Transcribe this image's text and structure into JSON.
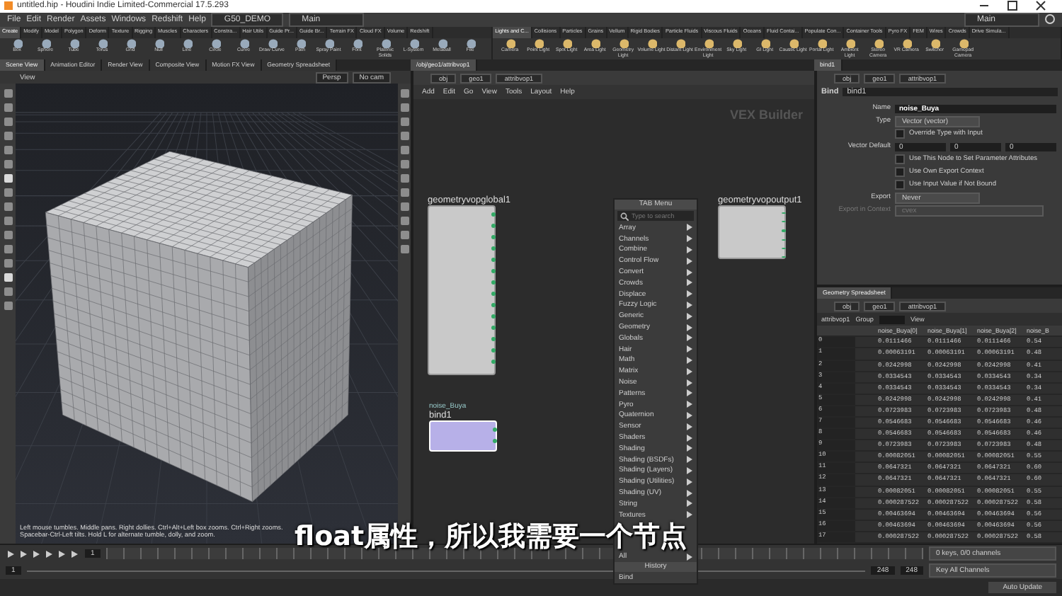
{
  "window": {
    "title": "untitled.hip - Houdini Indie Limited-Commercial 17.5.293"
  },
  "menu_bar": {
    "items": [
      "File",
      "Edit",
      "Render",
      "Assets",
      "Windows",
      "Redshift",
      "Help"
    ],
    "desktop": "G50_DEMO",
    "main": "Main"
  },
  "title_main": "Main",
  "shelf_left": {
    "tabs": [
      {
        "label": "Create",
        "selected": true
      },
      {
        "label": "Modify",
        "selected": false
      },
      {
        "label": "Model",
        "selected": false
      },
      {
        "label": "Polygon",
        "selected": false
      },
      {
        "label": "Deform",
        "selected": false
      },
      {
        "label": "Texture",
        "selected": false
      },
      {
        "label": "Rigging",
        "selected": false
      },
      {
        "label": "Muscles",
        "selected": false
      },
      {
        "label": "Characters",
        "selected": false
      },
      {
        "label": "Constra...",
        "selected": false
      },
      {
        "label": "Hair Utils",
        "selected": false
      },
      {
        "label": "Guide Pr...",
        "selected": false
      },
      {
        "label": "Guide Br...",
        "selected": false
      },
      {
        "label": "Terrain FX",
        "selected": false
      },
      {
        "label": "Cloud FX",
        "selected": false
      },
      {
        "label": "Volume",
        "selected": false
      },
      {
        "label": "Redshift",
        "selected": false
      }
    ],
    "tools": [
      "Box",
      "Sphere",
      "Tube",
      "Torus",
      "Grid",
      "Null",
      "Line",
      "Circle",
      "Curve",
      "Draw Curve",
      "Path",
      "Spray Paint",
      "Font",
      "Platonic Solids",
      "L-System",
      "Metaball",
      "File"
    ]
  },
  "shelf_right": {
    "tabs": [
      {
        "label": "Lights and C...",
        "selected": true
      },
      {
        "label": "Collisions",
        "selected": false
      },
      {
        "label": "Particles",
        "selected": false
      },
      {
        "label": "Grains",
        "selected": false
      },
      {
        "label": "Vellum",
        "selected": false
      },
      {
        "label": "Rigid Bodies",
        "selected": false
      },
      {
        "label": "Particle Fluids",
        "selected": false
      },
      {
        "label": "Viscous Fluids",
        "selected": false
      },
      {
        "label": "Oceans",
        "selected": false
      },
      {
        "label": "Fluid Contai...",
        "selected": false
      },
      {
        "label": "Populate Con...",
        "selected": false
      },
      {
        "label": "Container Tools",
        "selected": false
      },
      {
        "label": "Pyro FX",
        "selected": false
      },
      {
        "label": "FEM",
        "selected": false
      },
      {
        "label": "Wires",
        "selected": false
      },
      {
        "label": "Crowds",
        "selected": false
      },
      {
        "label": "Drive Simula...",
        "selected": false
      }
    ],
    "tools": [
      "Camera",
      "Point Light",
      "Spot Light",
      "Area Light",
      "Geometry Light",
      "Volume Light",
      "Distant Light",
      "Environment Light",
      "Sky Light",
      "GI Light",
      "Caustic Light",
      "Portal Light",
      "Ambient Light",
      "Stereo Camera",
      "VR Camera",
      "Switcher",
      "Gamepad Camera"
    ]
  },
  "pane_tabs": [
    {
      "label": "Scene View",
      "selected": true
    },
    {
      "label": "Animation Editor",
      "selected": false
    },
    {
      "label": "Render View",
      "selected": false
    },
    {
      "label": "Composite View",
      "selected": false
    },
    {
      "label": "Motion FX View",
      "selected": false
    },
    {
      "label": "Geometry Spreadsheet",
      "selected": false
    }
  ],
  "network_tab": "/obj/geo1/attribvop1",
  "params_tab": "bind1",
  "viewport": {
    "title": "View",
    "camera": "Persp",
    "cam_menu": "No cam",
    "hint": "Left mouse tumbles. Middle pans. Right dollies. Ctrl+Alt+Left box zooms. Ctrl+Right zooms. Spacebar-Ctrl-Left tilts. Hold L for alternate tumble, dolly, and zoom."
  },
  "network": {
    "path": [
      "obj",
      "geo1",
      "attribvop1"
    ],
    "menu": [
      "Add",
      "Edit",
      "Go",
      "View",
      "Tools",
      "Layout",
      "Help"
    ],
    "context": "VEX Builder",
    "nodes": [
      {
        "name": "geometryvopglobal1",
        "selected": false
      },
      {
        "name": "geometryvopoutput1",
        "selected": false
      },
      {
        "name": "bind1",
        "comment": "noise_Buya",
        "selected": true
      }
    ]
  },
  "tab_menu": {
    "title": "TAB Menu",
    "placeholder": "Type to search",
    "items": [
      "Array",
      "Channels",
      "Combine",
      "Control Flow",
      "Convert",
      "Crowds",
      "Displace",
      "Fuzzy Logic",
      "Generic",
      "Geometry",
      "Globals",
      "Hair",
      "Math",
      "Matrix",
      "Noise",
      "Patterns",
      "Pyro",
      "Quaternion",
      "Sensor",
      "Shaders",
      "Shading",
      "Shading (BSDFs)",
      "Shading (Layers)",
      "Shading (Utilities)",
      "Shading (UV)",
      "String",
      "Textures"
    ],
    "all": "All",
    "history": "History",
    "recent": [
      "Bind"
    ]
  },
  "parameters": {
    "path": [
      "obj",
      "geo1",
      "attribvop1"
    ],
    "node_type": "Bind",
    "node_name": "bind1",
    "rows": [
      {
        "kind": "text",
        "label": "Name",
        "value": "noise_Buya"
      },
      {
        "kind": "menu",
        "label": "Type",
        "value": "Vector (vector)",
        "disabled": false
      },
      {
        "kind": "check",
        "label": "Override Type with Input",
        "checked": false
      },
      {
        "kind": "vector",
        "label": "Vector Default",
        "values": [
          "0",
          "0",
          "0"
        ]
      },
      {
        "kind": "check",
        "label": "Use This Node to Set Parameter Attributes",
        "checked": false
      },
      {
        "kind": "check",
        "label": "Use Own Export Context",
        "checked": false
      },
      {
        "kind": "check",
        "label": "Use Input Value if Not Bound",
        "checked": false
      },
      {
        "kind": "menu",
        "label": "Export",
        "value": "Never",
        "disabled": false
      },
      {
        "kind": "menu",
        "label": "Export in Context",
        "value": "cvex",
        "disabled": true
      }
    ]
  },
  "spreadsheet": {
    "tab": "Geometry Spreadsheet",
    "path": [
      "obj",
      "geo1",
      "attribvop1"
    ],
    "node": "attribvop1",
    "group_label": "Group",
    "view_label": "View",
    "columns": [
      "noise_Buya[0]",
      "noise_Buya[1]",
      "noise_Buya[2]",
      "noise_B"
    ],
    "rows": [
      {
        "index": "0",
        "values": [
          "0.0111466",
          "0.0111466",
          "0.0111466",
          "0.54"
        ]
      },
      {
        "index": "1",
        "values": [
          "0.00063191",
          "0.00063191",
          "0.00063191",
          "0.48"
        ]
      },
      {
        "index": "2",
        "values": [
          "0.0242998",
          "0.0242998",
          "0.0242998",
          "0.41"
        ]
      },
      {
        "index": "3",
        "values": [
          "0.0334543",
          "0.0334543",
          "0.0334543",
          "0.34"
        ]
      },
      {
        "index": "4",
        "values": [
          "0.0334543",
          "0.0334543",
          "0.0334543",
          "0.34"
        ]
      },
      {
        "index": "5",
        "values": [
          "0.0242998",
          "0.0242998",
          "0.0242998",
          "0.41"
        ]
      },
      {
        "index": "6",
        "values": [
          "0.0723983",
          "0.0723983",
          "0.0723983",
          "0.48"
        ]
      },
      {
        "index": "7",
        "values": [
          "0.0546683",
          "0.0546683",
          "0.0546683",
          "0.46"
        ]
      },
      {
        "index": "8",
        "values": [
          "0.0546683",
          "0.0546683",
          "0.0546683",
          "0.46"
        ]
      },
      {
        "index": "9",
        "values": [
          "0.0723983",
          "0.0723983",
          "0.0723983",
          "0.48"
        ]
      },
      {
        "index": "10",
        "values": [
          "0.00082051",
          "0.00082051",
          "0.00082051",
          "0.55"
        ]
      },
      {
        "index": "11",
        "values": [
          "0.0647321",
          "0.0647321",
          "0.0647321",
          "0.60"
        ]
      },
      {
        "index": "12",
        "values": [
          "0.0647321",
          "0.0647321",
          "0.0647321",
          "0.60"
        ]
      },
      {
        "index": "13",
        "values": [
          "0.00082051",
          "0.00082051",
          "0.00082051",
          "0.55"
        ]
      },
      {
        "index": "14",
        "values": [
          "0.000287522",
          "0.000287522",
          "0.000287522",
          "0.58"
        ]
      },
      {
        "index": "15",
        "values": [
          "0.00463694",
          "0.00463694",
          "0.00463694",
          "0.56"
        ]
      },
      {
        "index": "16",
        "values": [
          "0.00463694",
          "0.00463694",
          "0.00463694",
          "0.56"
        ]
      },
      {
        "index": "17",
        "values": [
          "0.000287522",
          "0.000287522",
          "0.000287522",
          "0.58"
        ]
      }
    ]
  },
  "timeline": {
    "start": "1",
    "current": "1",
    "range_end": "248",
    "end": "248",
    "keys": "0 keys, 0/0 channels",
    "key_all": "Key All Channels",
    "auto_update": "Auto Update"
  },
  "subtitle": "float属性，所以我需要一个节点"
}
